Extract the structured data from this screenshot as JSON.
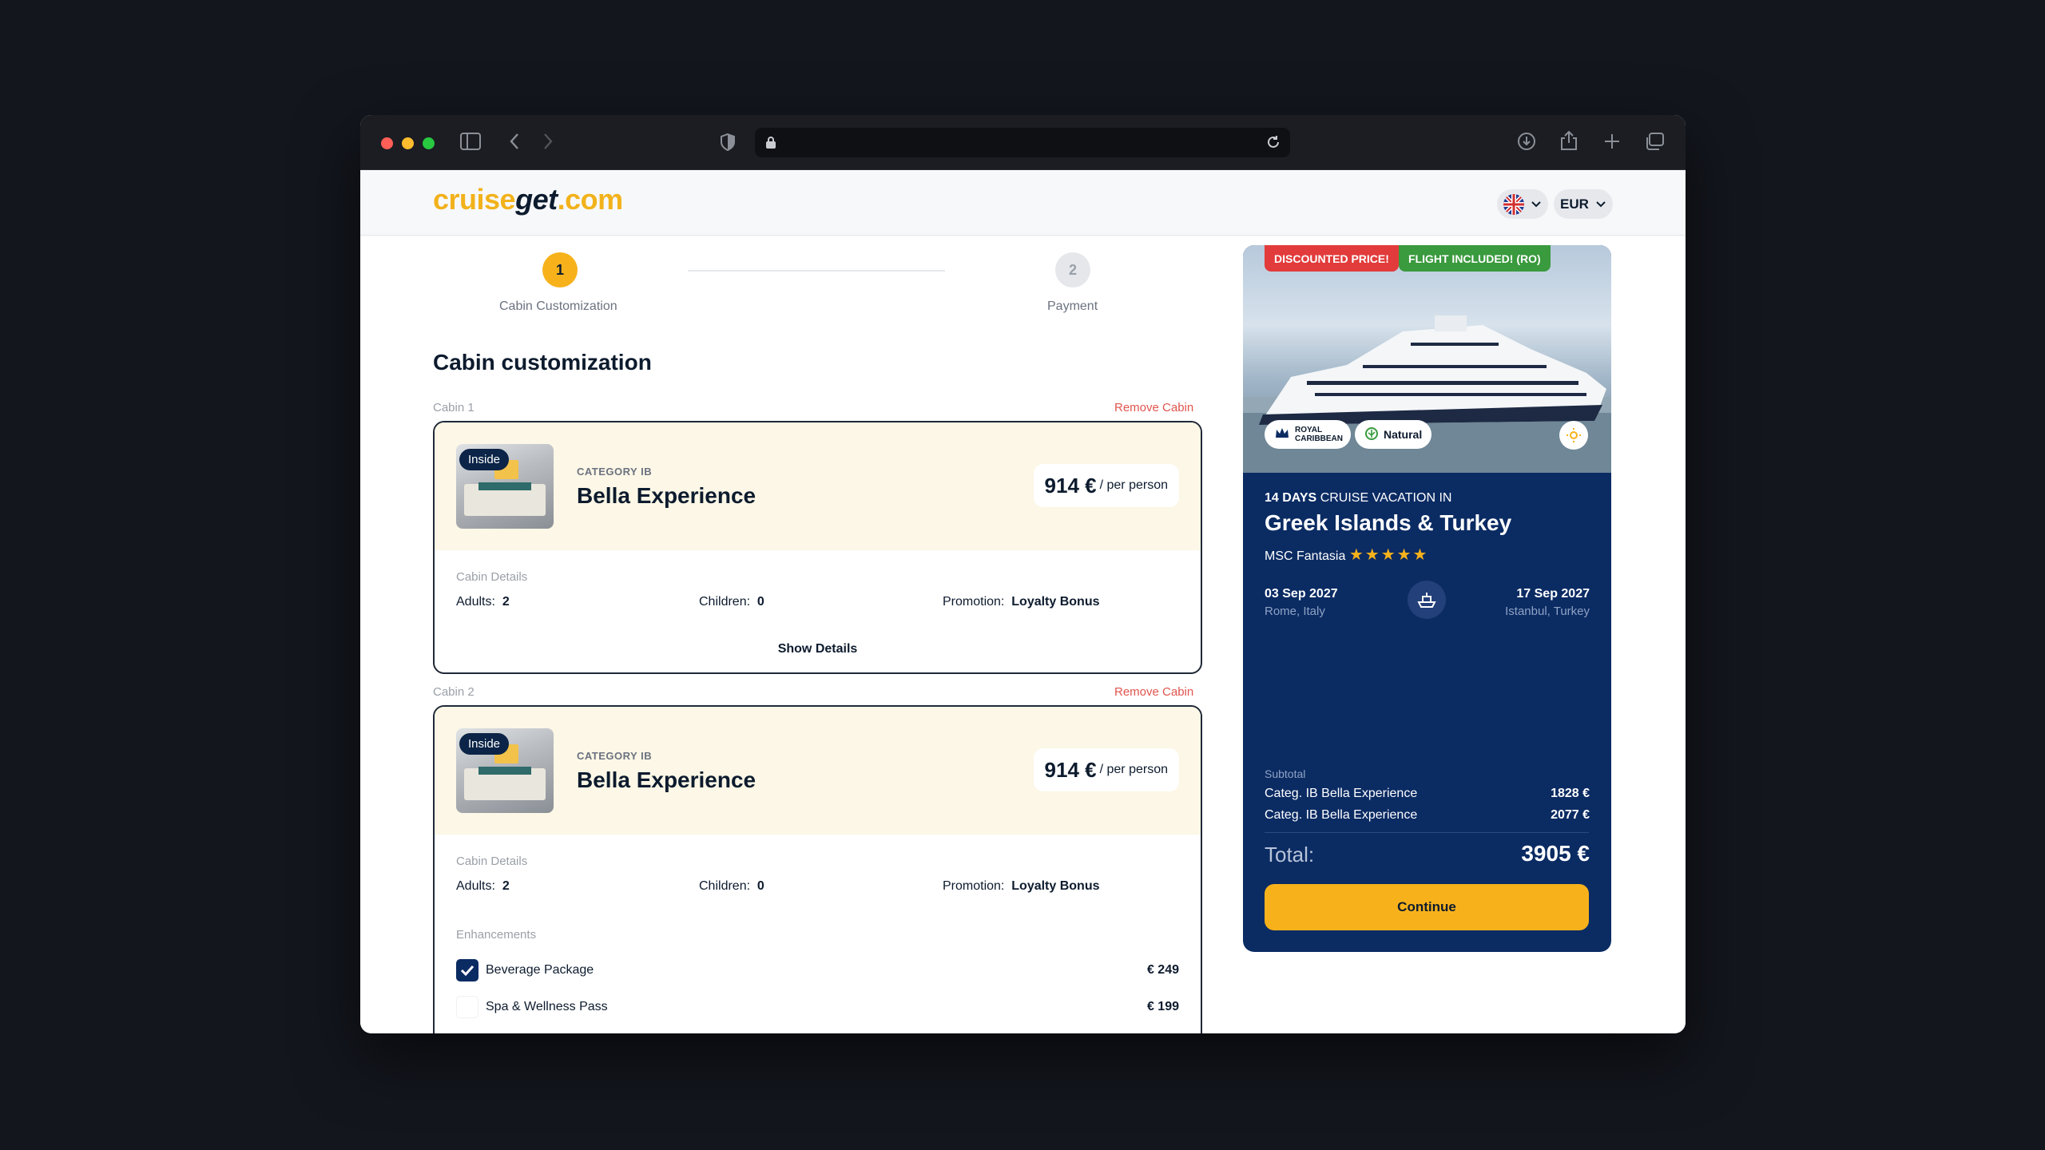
{
  "header": {
    "logo_part1": "cruise",
    "logo_part2": "get",
    "logo_part3": ".com",
    "currency": "EUR"
  },
  "steps": [
    {
      "num": "1",
      "label": "Cabin Customization"
    },
    {
      "num": "2",
      "label": "Payment"
    }
  ],
  "page_title": "Cabin customization",
  "cabins": [
    {
      "title": "Cabin 1",
      "remove": "Remove  Cabin",
      "tag": "Inside",
      "category": "CATEGORY IB",
      "name": "Bella Experience",
      "price": "914 €",
      "price_unit": "/ per person",
      "details_title": "Cabin Details",
      "adults_label": "Adults:",
      "adults": "2",
      "children_label": "Children:",
      "children": "0",
      "promotion_label": "Promotion:",
      "promotion": "Loyalty Bonus",
      "show_details": "Show Details"
    },
    {
      "title": "Cabin 2",
      "remove": "Remove  Cabin",
      "tag": "Inside",
      "category": "CATEGORY IB",
      "name": "Bella Experience",
      "price": "914 €",
      "price_unit": "/ per person",
      "details_title": "Cabin Details",
      "adults_label": "Adults:",
      "adults": "2",
      "children_label": "Children:",
      "children": "0",
      "promotion_label": "Promotion:",
      "promotion": "Loyalty Bonus",
      "enhancements_title": "Enhancements",
      "enhancements": [
        {
          "label": "Beverage Package",
          "price": "€ 249",
          "checked": true
        },
        {
          "label": "Spa & Wellness Pass",
          "price": "€ 199",
          "checked": false
        }
      ]
    }
  ],
  "summary": {
    "badge_discount": "DISCOUNTED PRICE!",
    "badge_flight": "FLIGHT INCLUDED! (RO)",
    "chip_brand": "ROYAL CARIBBEAN",
    "chip_natural": "Natural",
    "days": "14 DAYS",
    "days_suffix": "CRUISE VACATION IN",
    "destination": "Greek Islands & Turkey",
    "ship": "MSC Fantasia",
    "stars": "★★★★★",
    "depart_date": "03 Sep 2027",
    "depart_place": "Rome, Italy",
    "arrive_date": "17 Sep 2027",
    "arrive_place": "Istanbul, Turkey",
    "subtotal_label": "Subtotal",
    "lines": [
      {
        "label": "Categ. IB Bella Experience",
        "amount": "1828 €"
      },
      {
        "label": "Categ. IB Bella Experience",
        "amount": "2077 €"
      }
    ],
    "total_label": "Total:",
    "total": "3905 €",
    "continue": "Continue"
  },
  "colors": {
    "accent": "#f7b21b",
    "navy": "#0b2b63",
    "danger": "#e0554e",
    "success": "#3a9a3e"
  }
}
